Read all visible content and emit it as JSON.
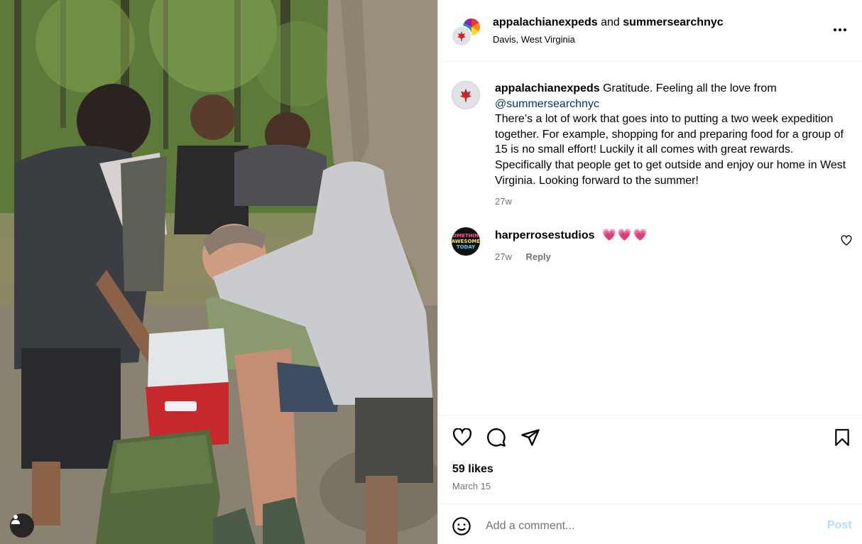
{
  "photo": {
    "description_icon": "person-tag-icon"
  },
  "header": {
    "author": "appalachianexpeds",
    "joiner": "and",
    "collaborator": "summersearchnyc",
    "location": "Davis, West Virginia",
    "more_icon": "more-horizontal-icon"
  },
  "caption": {
    "username": "appalachianexpeds",
    "text_start": "Gratitude. Feeling all the love from",
    "mention": "@summersearchnyc",
    "body": "There’s a lot of work that goes into to putting a two week expedition together. For example, shopping for and preparing food for a group of 15 is no small effort! Luckily it all comes with great rewards. Specifically that people get to get outside and enjoy our home in West Virginia. Looking forward to the summer!",
    "time": "27w"
  },
  "comment": {
    "username": "harperrosestudios",
    "text": "💗💗💗",
    "time": "27w",
    "reply_label": "Reply",
    "avatar_lines": [
      "SOMETHING",
      "AWESOME",
      "TODAY"
    ]
  },
  "actions": {
    "likes": "59 likes",
    "date": "March 15"
  },
  "comment_bar": {
    "placeholder": "Add a comment...",
    "post_label": "Post"
  },
  "colors": {
    "link": "#00376b",
    "muted": "#737373",
    "post_button_disabled": "#b2dffc",
    "hearts": "#ff3066"
  }
}
